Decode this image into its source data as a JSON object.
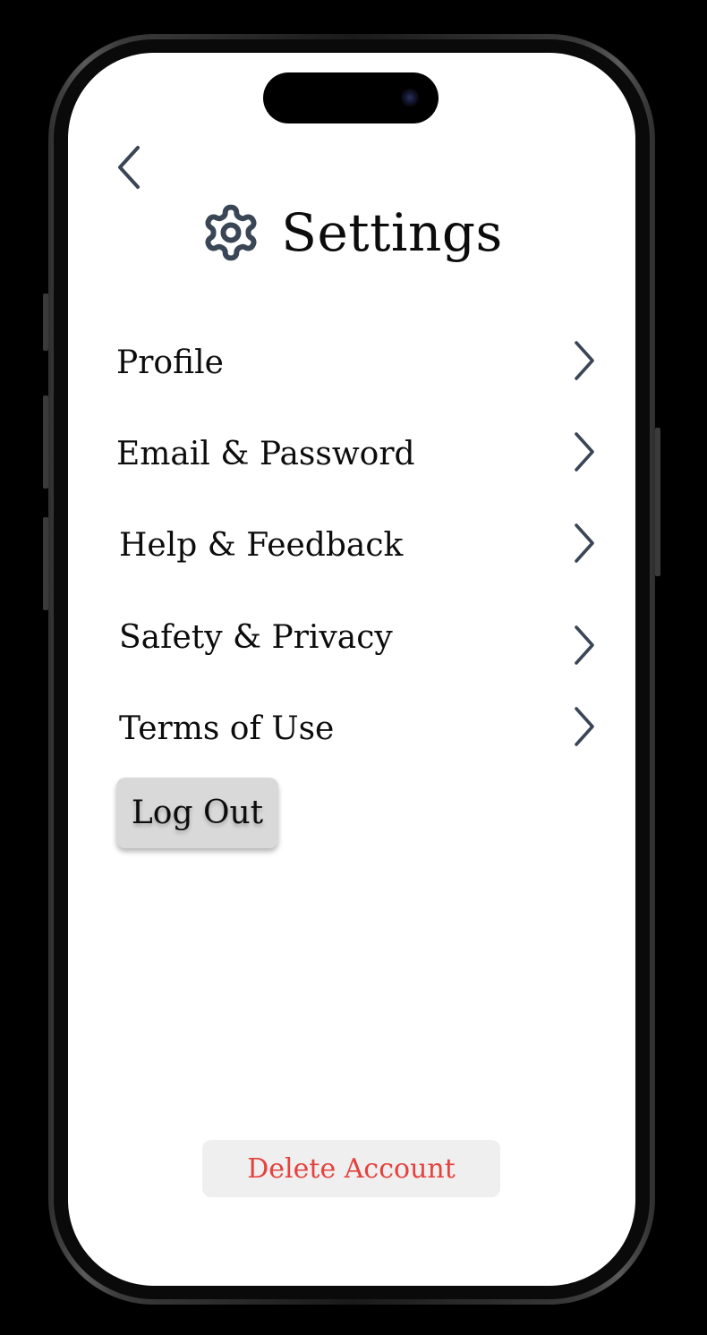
{
  "colors": {
    "icon_stroke": "#3a4656",
    "text_primary": "#0c0c0c",
    "danger": "#e5423f",
    "logout_bg": "#d9d9d9",
    "delete_bg": "#efefef"
  },
  "header": {
    "back_icon": "chevron-left-icon",
    "title_icon": "gear-icon",
    "title": "Settings"
  },
  "menu": {
    "items": [
      {
        "label": "Profile",
        "icon": "chevron-right-icon"
      },
      {
        "label": "Email & Password",
        "icon": "chevron-right-icon"
      },
      {
        "label": "Help & Feedback",
        "icon": "chevron-right-icon"
      },
      {
        "label": "Safety & Privacy",
        "icon": "chevron-right-icon"
      },
      {
        "label": "Terms of Use",
        "icon": "chevron-right-icon"
      }
    ]
  },
  "actions": {
    "logout_label": "Log Out",
    "delete_label": "Delete Account"
  }
}
